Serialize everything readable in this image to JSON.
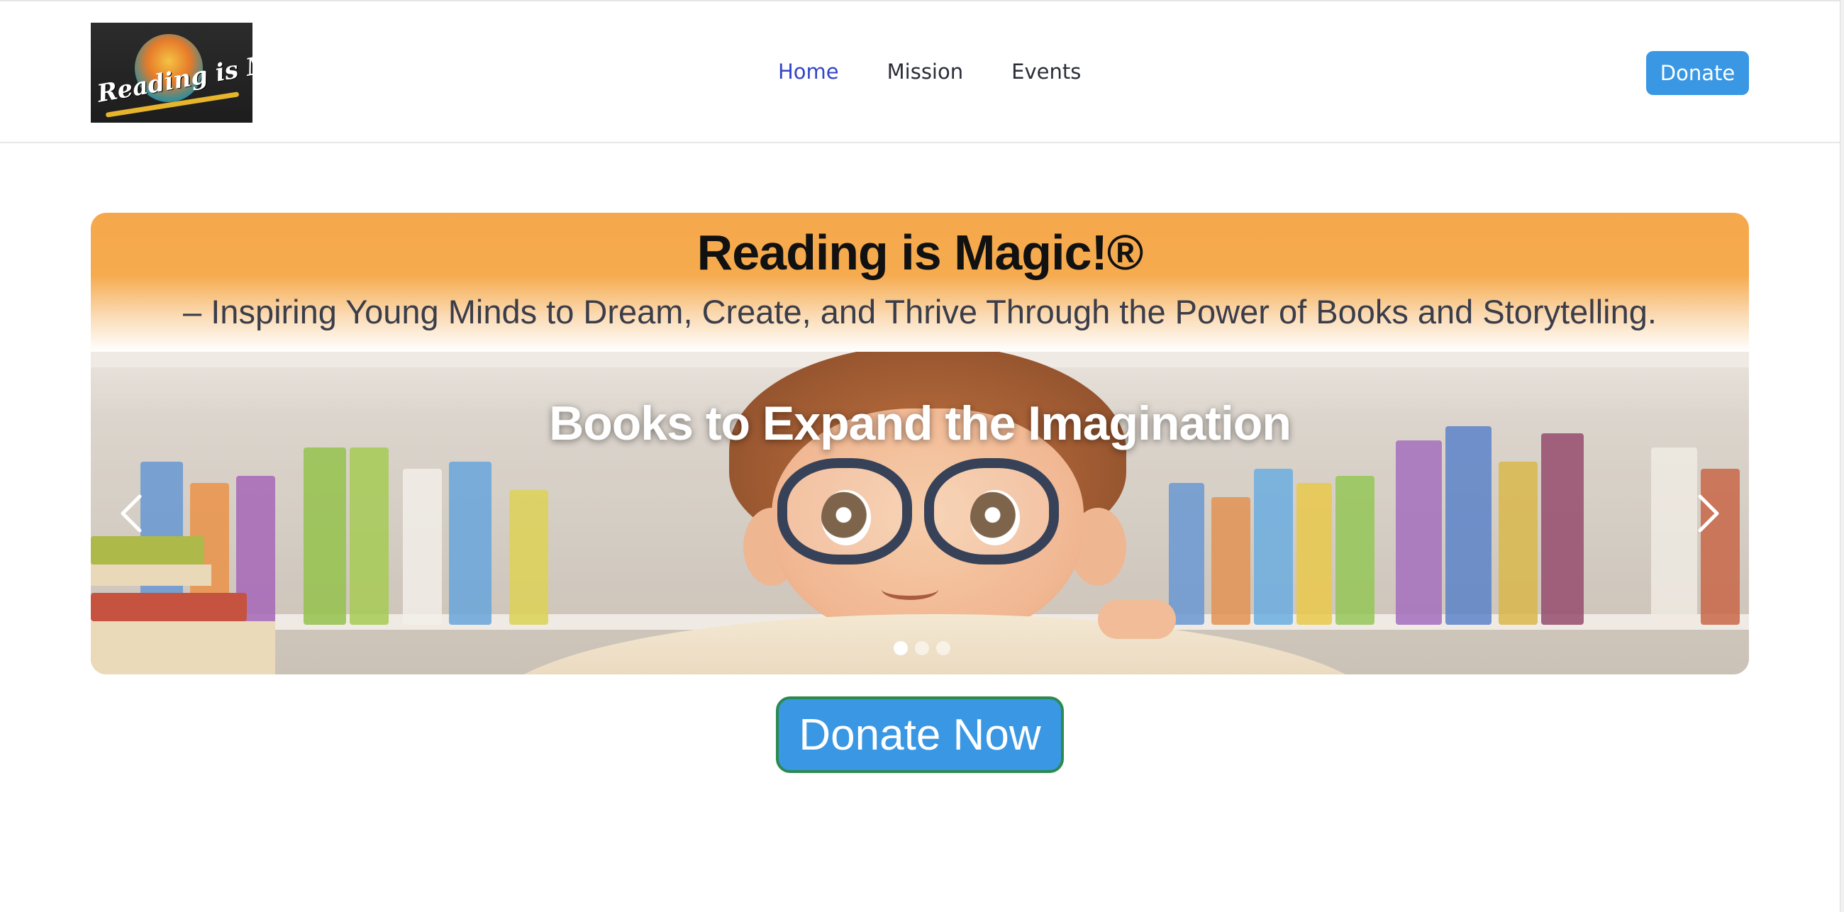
{
  "header": {
    "logo": {
      "text": "Reading is Magic!",
      "icon": "logo-image"
    },
    "nav": [
      {
        "label": "Home",
        "active": true
      },
      {
        "label": "Mission",
        "active": false
      },
      {
        "label": "Events",
        "active": false
      }
    ],
    "donate_label": "Donate"
  },
  "hero": {
    "title": "Reading is Magic!®",
    "subtitle": "– Inspiring Young Minds to Dream, Create, and Thrive Through the Power of Books and Storytelling.",
    "slide_caption": "Books to Expand the Imagination",
    "prev_icon": "chevron-left-icon",
    "next_icon": "chevron-right-icon",
    "slide_count": 3,
    "active_slide": 1
  },
  "cta": {
    "donate_now_label": "Donate Now"
  },
  "colors": {
    "accent_blue": "#3a97e4",
    "nav_active": "#3346c7",
    "banner_orange": "#f5a84b",
    "donate_border": "#2c8a4f"
  }
}
